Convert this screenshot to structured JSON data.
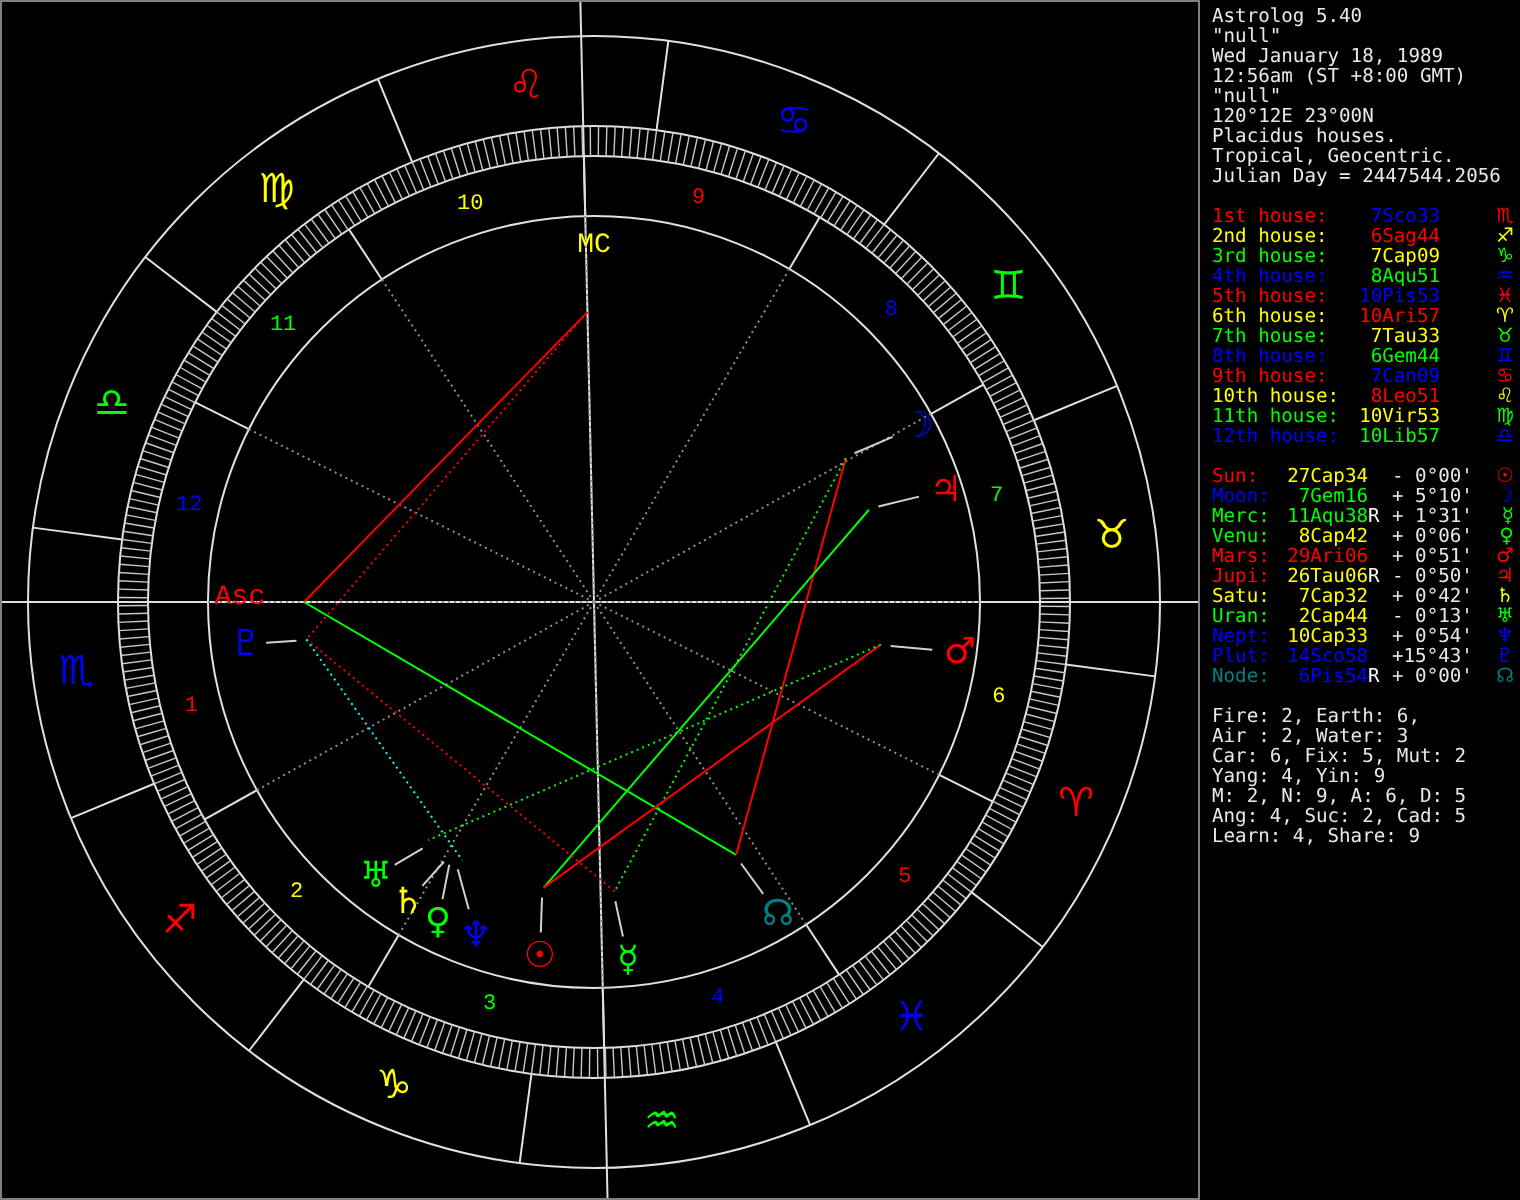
{
  "info": [
    "Astrolog 5.40",
    "\"null\"",
    "Wed January 18, 1989",
    "12:56am (ST +8:00 GMT)",
    "\"null\"",
    "120°12E 23°00N",
    "Placidus houses.",
    "Tropical, Geocentric.",
    "Julian Day = 2447544.2056"
  ],
  "houses": [
    {
      "label": "1st house:",
      "color": "#ff0000",
      "cusp": {
        "text": "7Sco33",
        "color": "#0000ff"
      },
      "glyph": "♏"
    },
    {
      "label": "2nd house:",
      "color": "#ffff00",
      "cusp": {
        "text": "6Sag44",
        "color": "#ff0000"
      },
      "glyph": "♐"
    },
    {
      "label": "3rd house:",
      "color": "#00ff00",
      "cusp": {
        "text": "7Cap09",
        "color": "#ffff00"
      },
      "glyph": "♑"
    },
    {
      "label": "4th house:",
      "color": "#0000ff",
      "cusp": {
        "text": "8Aqu51",
        "color": "#00ff00"
      },
      "glyph": "♒"
    },
    {
      "label": "5th house:",
      "color": "#ff0000",
      "cusp": {
        "text": "10Pis53",
        "color": "#0000ff"
      },
      "glyph": "♓"
    },
    {
      "label": "6th house:",
      "color": "#ffff00",
      "cusp": {
        "text": "10Ari57",
        "color": "#ff0000"
      },
      "glyph": "♈"
    },
    {
      "label": "7th house:",
      "color": "#00ff00",
      "cusp": {
        "text": "7Tau33",
        "color": "#ffff00"
      },
      "glyph": "♉"
    },
    {
      "label": "8th house:",
      "color": "#0000ff",
      "cusp": {
        "text": "6Gem44",
        "color": "#00ff00"
      },
      "glyph": "♊"
    },
    {
      "label": "9th house:",
      "color": "#ff0000",
      "cusp": {
        "text": "7Can09",
        "color": "#0000ff"
      },
      "glyph": "♋"
    },
    {
      "label": "10th house:",
      "color": "#ffff00",
      "cusp": {
        "text": "8Leo51",
        "color": "#ff0000"
      },
      "glyph": "♌"
    },
    {
      "label": "11th house:",
      "color": "#00ff00",
      "cusp": {
        "text": "10Vir53",
        "color": "#ffff00"
      },
      "glyph": "♍"
    },
    {
      "label": "12th house:",
      "color": "#0000ff",
      "cusp": {
        "text": "10Lib57",
        "color": "#00ff00"
      },
      "glyph": "♎"
    }
  ],
  "planets": [
    {
      "name": "Sun:",
      "color": "#ff0000",
      "position": {
        "text": "27Cap34",
        "color": "#ffff00"
      },
      "motion": "- 0°00'",
      "glyph": "☉"
    },
    {
      "name": "Moon:",
      "color": "#0000ff",
      "position": {
        "text": "7Gem16",
        "color": "#00ff00"
      },
      "motion": "+ 5°10'",
      "glyph": "☽"
    },
    {
      "name": "Merc:",
      "color": "#00ff00",
      "position": {
        "text": "11Aqu38",
        "color": "#00ff00"
      },
      "retro": "R",
      "motion": "+ 1°31'",
      "glyph": "☿"
    },
    {
      "name": "Venu:",
      "color": "#00ff00",
      "position": {
        "text": "8Cap42",
        "color": "#ffff00"
      },
      "motion": "+ 0°06'",
      "glyph": "♀"
    },
    {
      "name": "Mars:",
      "color": "#ff0000",
      "position": {
        "text": "29Ari06",
        "color": "#ff0000"
      },
      "motion": "+ 0°51'",
      "glyph": "♂"
    },
    {
      "name": "Jupi:",
      "color": "#ff0000",
      "position": {
        "text": "26Tau06",
        "color": "#ffff00"
      },
      "retro": "R",
      "motion": "- 0°50'",
      "glyph": "♃"
    },
    {
      "name": "Satu:",
      "color": "#ffff00",
      "position": {
        "text": "7Cap32",
        "color": "#ffff00"
      },
      "motion": "+ 0°42'",
      "glyph": "♄"
    },
    {
      "name": "Uran:",
      "color": "#00ff00",
      "position": {
        "text": "2Cap44",
        "color": "#ffff00"
      },
      "motion": "- 0°13'",
      "glyph": "♅"
    },
    {
      "name": "Nept:",
      "color": "#0000ff",
      "position": {
        "text": "10Cap33",
        "color": "#ffff00"
      },
      "motion": "+ 0°54'",
      "glyph": "♆"
    },
    {
      "name": "Plut:",
      "color": "#0000ff",
      "position": {
        "text": "14Sco58",
        "color": "#0000ff"
      },
      "motion": "+15°43'",
      "glyph": "♇"
    },
    {
      "name": "Node:",
      "color": "#008080",
      "position": {
        "text": "6Pis54",
        "color": "#0000ff"
      },
      "retro": "R",
      "motion": "+ 0°00'",
      "glyph": "☊"
    }
  ],
  "stats": [
    "Fire: 2, Earth: 6,",
    "Air : 2, Water: 3",
    "Car: 6, Fix: 5, Mut: 2",
    "Yang: 4, Yin: 9",
    "M: 2, N: 9, A: 6, D: 5",
    "Ang: 4, Suc: 2, Cad: 5",
    "Learn: 4, Share: 9"
  ],
  "wheel": {
    "signs": [
      {
        "glyph": "♈",
        "color": "#ff0000"
      },
      {
        "glyph": "♉",
        "color": "#ffff00"
      },
      {
        "glyph": "♊",
        "color": "#00ff00"
      },
      {
        "glyph": "♋",
        "color": "#0000ff"
      },
      {
        "glyph": "♌",
        "color": "#ff0000"
      },
      {
        "glyph": "♍",
        "color": "#ffff00"
      },
      {
        "glyph": "♎",
        "color": "#00ff00"
      },
      {
        "glyph": "♏",
        "color": "#0000ff"
      },
      {
        "glyph": "♐",
        "color": "#ff0000"
      },
      {
        "glyph": "♑",
        "color": "#ffff00"
      },
      {
        "glyph": "♒",
        "color": "#00ff00"
      },
      {
        "glyph": "♓",
        "color": "#0000ff"
      }
    ],
    "house_numbers": [
      {
        "label": "1",
        "color": "#ff0000"
      },
      {
        "label": "2",
        "color": "#ffff00"
      },
      {
        "label": "3",
        "color": "#00ff00"
      },
      {
        "label": "4",
        "color": "#0000ff"
      },
      {
        "label": "5",
        "color": "#ff0000"
      },
      {
        "label": "6",
        "color": "#ffff00"
      },
      {
        "label": "7",
        "color": "#00ff00"
      },
      {
        "label": "8",
        "color": "#0000ff"
      },
      {
        "label": "9",
        "color": "#ff0000"
      },
      {
        "label": "10",
        "color": "#ffff00"
      },
      {
        "label": "11",
        "color": "#00ff00"
      },
      {
        "label": "12",
        "color": "#0000ff"
      }
    ],
    "angles": [
      {
        "label": "Asc",
        "color": "#ff0000"
      },
      {
        "label": "MC",
        "color": "#ffff00"
      }
    ],
    "planets": [
      {
        "glyph": "☉",
        "color": "#ff0000"
      },
      {
        "glyph": "☽",
        "color": "#0000ff"
      },
      {
        "glyph": "☿",
        "color": "#00ff00"
      },
      {
        "glyph": "♀",
        "color": "#00ff00"
      },
      {
        "glyph": "♂",
        "color": "#ff0000"
      },
      {
        "glyph": "♃",
        "color": "#ff0000"
      },
      {
        "glyph": "♄",
        "color": "#ffff00"
      },
      {
        "glyph": "♅",
        "color": "#00ff00"
      },
      {
        "glyph": "♆",
        "color": "#0000ff"
      },
      {
        "glyph": "♇",
        "color": "#0000ff"
      },
      {
        "glyph": "☊",
        "color": "#008080"
      }
    ]
  }
}
